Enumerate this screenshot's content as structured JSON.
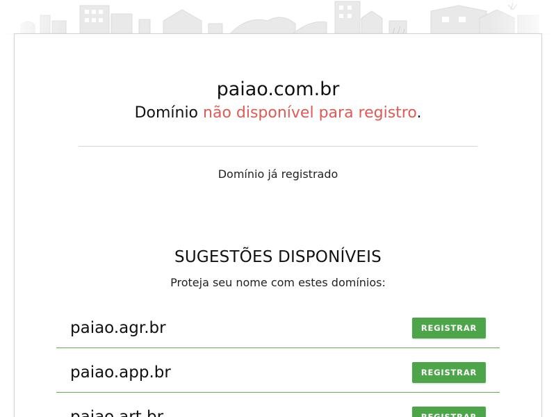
{
  "result": {
    "domain": "paiao.com.br",
    "status_prefix": "Domínio ",
    "status_highlight": "não disponível para registro",
    "status_suffix": ".",
    "detail": "Domínio já registrado"
  },
  "suggestions": {
    "title": "SUGESTÕES DISPONÍVEIS",
    "subtitle": "Proteja seu nome com estes domínios:",
    "button_label": "REGISTRAR",
    "items": [
      {
        "name": "paiao.agr.br"
      },
      {
        "name": "paiao.app.br"
      },
      {
        "name": "paiao.art.br"
      }
    ]
  },
  "colors": {
    "unavailable_text": "#e05a55",
    "register_button": "#4ea44a",
    "row_divider": "#6aa84f"
  }
}
